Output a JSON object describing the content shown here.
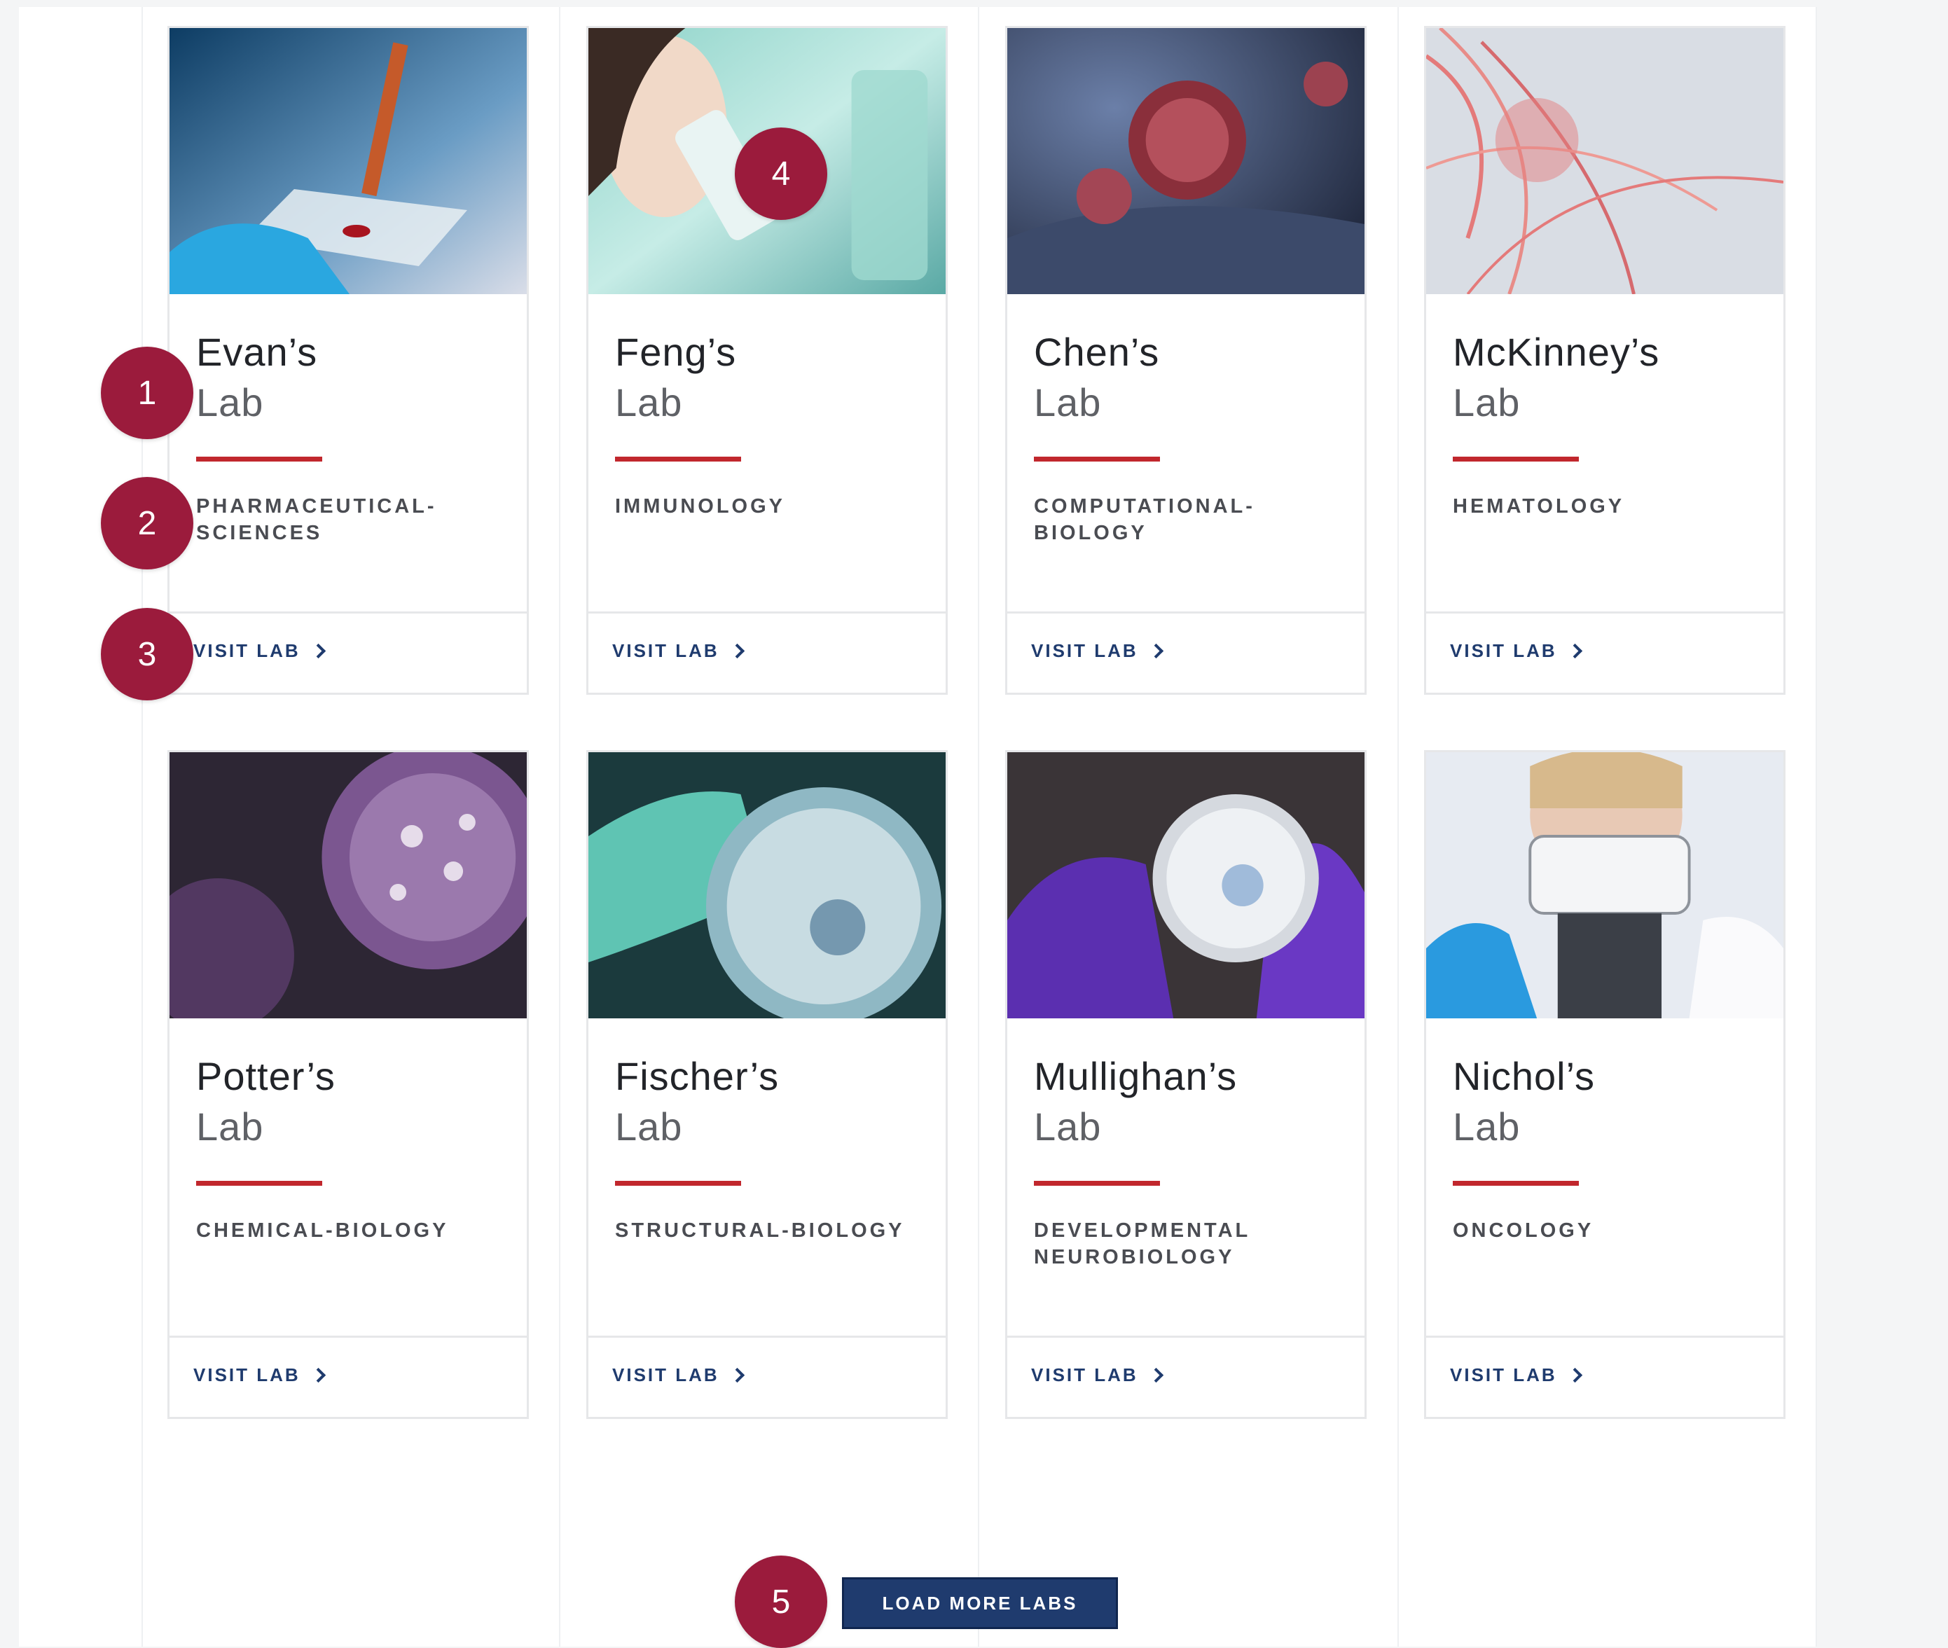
{
  "labs": [
    {
      "name": "Evan’s",
      "suffix": "Lab",
      "category": "PHARMACEUTICAL-SCIENCES",
      "link": "VISIT LAB"
    },
    {
      "name": "Feng’s",
      "suffix": "Lab",
      "category": "IMMUNOLOGY",
      "link": "VISIT LAB"
    },
    {
      "name": "Chen’s",
      "suffix": "Lab",
      "category": "COMPUTATIONAL-BIOLOGY",
      "link": "VISIT LAB"
    },
    {
      "name": "McKinney’s",
      "suffix": "Lab",
      "category": "HEMATOLOGY",
      "link": "VISIT LAB"
    },
    {
      "name": "Potter’s",
      "suffix": "Lab",
      "category": "CHEMICAL-BIOLOGY",
      "link": "VISIT LAB"
    },
    {
      "name": "Fischer’s",
      "suffix": "Lab",
      "category": "STRUCTURAL-BIOLOGY",
      "link": "VISIT LAB"
    },
    {
      "name": "Mullighan’s",
      "suffix": "Lab",
      "category": "DEVELOPMENTAL NEUROBIOLOGY",
      "link": "VISIT LAB"
    },
    {
      "name": "Nichol’s",
      "suffix": "Lab",
      "category": "ONCOLOGY",
      "link": "VISIT LAB"
    }
  ],
  "load_more_label": "LOAD MORE LABS",
  "markers": [
    "1",
    "2",
    "3",
    "4",
    "5"
  ],
  "image_subjects": [
    "pipette-slide-image",
    "microscope-researcher-image",
    "cell-3d-render-image",
    "fibers-render-image",
    "purple-cells-image",
    "petri-dish-hand-image",
    "petri-dish-purple-gloves-image",
    "microscope-scientist-image"
  ],
  "colors": {
    "accent_red": "#c1272d",
    "navy": "#1f3b6e",
    "marker": "#9b1b3c"
  }
}
